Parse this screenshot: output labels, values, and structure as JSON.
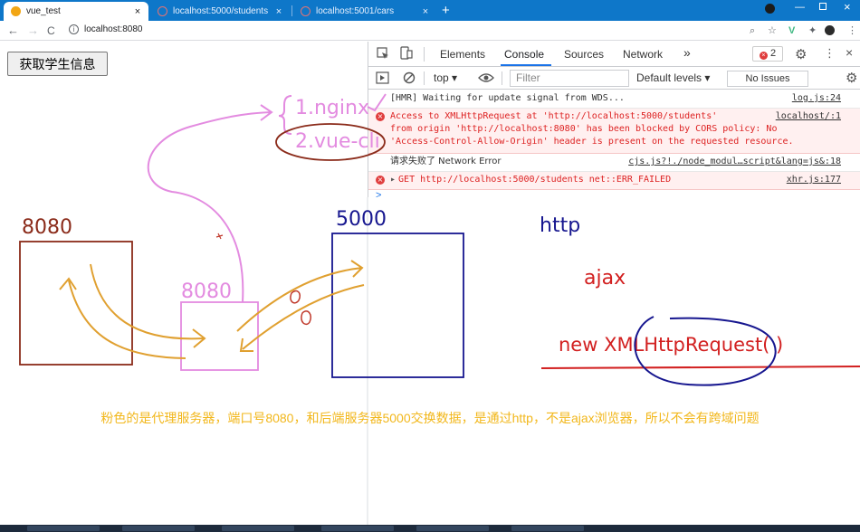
{
  "tabs": [
    {
      "title": "vue_test",
      "close": "×",
      "favicon_color": "#f2a614"
    },
    {
      "title": "localhost:5000/students",
      "close": "×",
      "favicon_color": "#c0392b"
    },
    {
      "title": "localhost:5001/cars",
      "close": "×",
      "favicon_color": "#c0392b"
    }
  ],
  "newtab": "+",
  "address": {
    "url": "localhost:8080",
    "back": "←",
    "forward": "→",
    "reload": "C",
    "info": "i"
  },
  "page": {
    "button_label": "获取学生信息"
  },
  "devtools": {
    "tabs": [
      "Elements",
      "Console",
      "Sources",
      "Network"
    ],
    "more": "»",
    "error_count": "2",
    "context": "top",
    "filter_placeholder": "Filter",
    "levels": "Default levels",
    "issues": "No Issues",
    "messages": [
      {
        "level": "info",
        "text": "[HMR] Waiting for update signal from WDS...",
        "source": "log.js:24"
      },
      {
        "level": "error",
        "line1_pre": "Access to XMLHttpRequest at '",
        "line1_link": "http://localhost:5000/students",
        "line1_post": "'",
        "line2_pre": "from origin '",
        "line2_link": "http://localhost:8080",
        "line2_post": "' has been blocked by CORS policy: No",
        "line3": "'Access-Control-Allow-Origin' header is present on the requested resource.",
        "source": "localhost/:1"
      },
      {
        "level": "log",
        "text": "请求失败了 Network Error",
        "source": "cjs.js?!./node_modul…script&lang=js&:18"
      },
      {
        "level": "error",
        "method": "GET",
        "link": "http://localhost:5000/students",
        "tail": "net::ERR_FAILED",
        "source": "xhr.js:177"
      }
    ],
    "prompt": ">"
  },
  "annotations": {
    "nginx": "1.nginx",
    "vuecli": "2.vue-cli",
    "label_client": "8080",
    "label_proxy": "8080",
    "label_server": "5000",
    "http": "http",
    "ajax": "ajax",
    "xhr": "new XMLHttpRequest( )",
    "caption": "粉色的是代理服务器，端口号8080，和后端服务器5000交换数据，是通过http，不是ajax浏览器，所以不会有跨域问题"
  },
  "colors": {
    "tabstrip": "#0e77c9",
    "pink": "#e38be0",
    "maroon": "#8b2b1a",
    "orange": "#e0a030",
    "navy": "#16168f",
    "red": "#d22020",
    "caption": "#f2b71b"
  }
}
